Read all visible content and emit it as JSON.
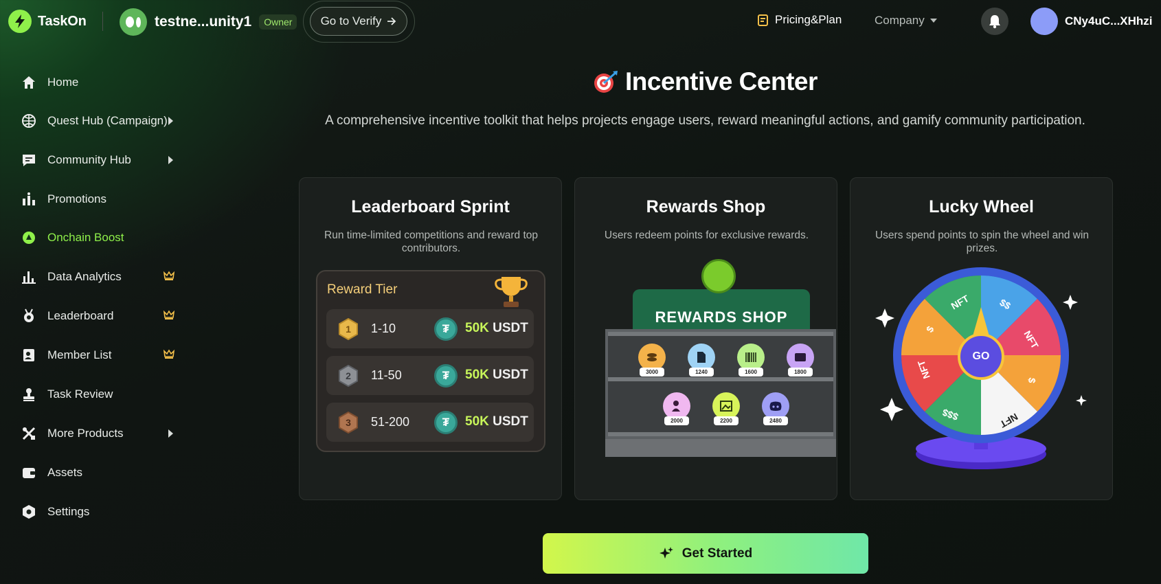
{
  "header": {
    "logo_text": "TaskOn",
    "community_name": "testne...unity1",
    "owner_badge": "Owner",
    "verify_label": "Go to Verify",
    "pricing_label": "Pricing&Plan",
    "company_label": "Company",
    "user_name": "CNy4uC...XHhzi"
  },
  "sidebar": {
    "items": [
      {
        "label": "Home",
        "icon": "home-icon"
      },
      {
        "label": "Quest Hub (Campaign)",
        "icon": "globe-icon",
        "has_submenu": true
      },
      {
        "label": "Community Hub",
        "icon": "chat-icon",
        "has_submenu": true
      },
      {
        "label": "Promotions",
        "icon": "chart-person-icon"
      },
      {
        "label": "Onchain Boost",
        "icon": "boost-icon",
        "active": true
      },
      {
        "label": "Data Analytics",
        "icon": "bar-chart-icon",
        "premium": true
      },
      {
        "label": "Leaderboard",
        "icon": "medal-icon",
        "premium": true
      },
      {
        "label": "Member List",
        "icon": "id-card-icon",
        "premium": true
      },
      {
        "label": "Task Review",
        "icon": "stamp-icon"
      },
      {
        "label": "More Products",
        "icon": "tools-icon",
        "has_submenu": true
      },
      {
        "label": "Assets",
        "icon": "wallet-icon"
      },
      {
        "label": "Settings",
        "icon": "hexagon-gear-icon"
      }
    ]
  },
  "main": {
    "title": "Incentive Center",
    "subtitle": "A comprehensive incentive toolkit that helps projects engage users, reward meaningful actions, and gamify community participation.",
    "cards": [
      {
        "title": "Leaderboard Sprint",
        "desc": "Run time-limited competitions and reward top contributors."
      },
      {
        "title": "Rewards Shop",
        "desc": "Users redeem points for exclusive rewards."
      },
      {
        "title": "Lucky Wheel",
        "desc": "Users spend points to spin the wheel and win prizes."
      }
    ],
    "reward_tier": {
      "title": "Reward Tier",
      "rows": [
        {
          "medal": "1",
          "range": "1-10",
          "amount": "50K",
          "unit": "USDT",
          "color": "#e8b84a"
        },
        {
          "medal": "2",
          "range": "11-50",
          "amount": "50K",
          "unit": "USDT",
          "color": "#8d9095"
        },
        {
          "medal": "3",
          "range": "51-200",
          "amount": "50K",
          "unit": "USDT",
          "color": "#b07550"
        }
      ],
      "coin_symbol": "₮"
    },
    "shop": {
      "sign": "REWARDS SHOP",
      "items": [
        {
          "price": "3000",
          "color": "#f4b24a",
          "icon": "coins-icon"
        },
        {
          "price": "1240",
          "color": "#9fd3f5",
          "icon": "document-icon"
        },
        {
          "price": "1600",
          "color": "#b9ef8a",
          "icon": "barcode-icon"
        },
        {
          "price": "1800",
          "color": "#c8a4f5",
          "icon": "ticket-icon"
        },
        {
          "price": "2000",
          "color": "#f0b8f0",
          "icon": "user-check-icon"
        },
        {
          "price": "2200",
          "color": "#d8f45a",
          "icon": "image-icon"
        },
        {
          "price": "2480",
          "color": "#9f9ff5",
          "icon": "discord-icon"
        }
      ]
    },
    "wheel": {
      "go_label": "GO",
      "segments": [
        "NFT",
        "$$",
        "NFT",
        "$",
        "NFT",
        "$$$",
        "NFT",
        "$"
      ]
    },
    "cta_label": "Get Started"
  },
  "colors": {
    "accent": "#8ff04a",
    "cta_gradient_start": "#d2f64b",
    "cta_gradient_end": "#6fe7a8",
    "card_bg": "#1b1f1d"
  }
}
